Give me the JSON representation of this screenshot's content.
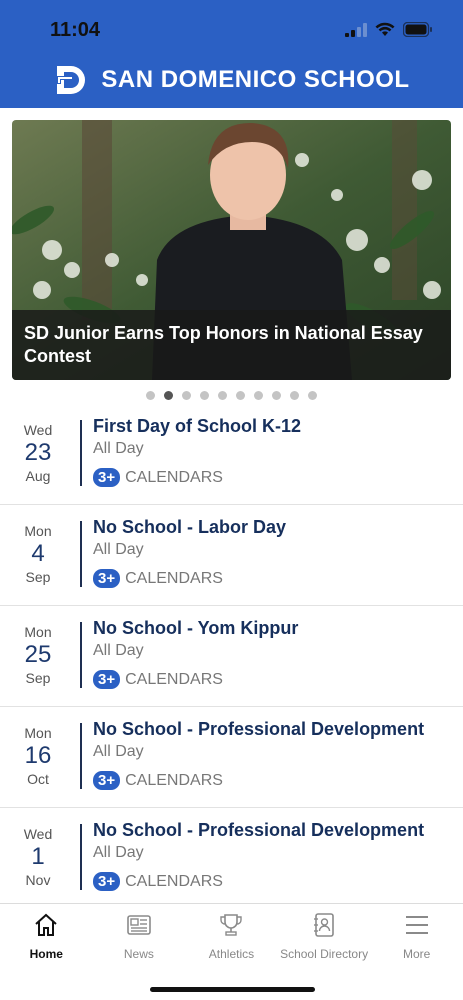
{
  "status_bar": {
    "time": "11:04"
  },
  "header": {
    "title": "SAN DOMENICO SCHOOL"
  },
  "hero": {
    "caption": "SD Junior Earns Top Honors in National Essay Contest"
  },
  "carousel": {
    "count": 10,
    "active_index": 1
  },
  "events": [
    {
      "dow": "Wed",
      "day": "23",
      "month": "Aug",
      "title": "First Day of School K-12",
      "time": "All Day",
      "badge": "3+",
      "calendars_label": "CALENDARS"
    },
    {
      "dow": "Mon",
      "day": "4",
      "month": "Sep",
      "title": "No School - Labor Day",
      "time": "All Day",
      "badge": "3+",
      "calendars_label": "CALENDARS"
    },
    {
      "dow": "Mon",
      "day": "25",
      "month": "Sep",
      "title": "No School - Yom Kippur",
      "time": "All Day",
      "badge": "3+",
      "calendars_label": "CALENDARS"
    },
    {
      "dow": "Mon",
      "day": "16",
      "month": "Oct",
      "title": "No School - Professional Development",
      "time": "All Day",
      "badge": "3+",
      "calendars_label": "CALENDARS"
    },
    {
      "dow": "Wed",
      "day": "1",
      "month": "Nov",
      "title": "No School - Professional Development",
      "time": "All Day",
      "badge": "3+",
      "calendars_label": "CALENDARS"
    }
  ],
  "tabs": [
    {
      "label": "Home",
      "icon": "home-icon",
      "active": true
    },
    {
      "label": "News",
      "icon": "news-icon",
      "active": false
    },
    {
      "label": "Athletics",
      "icon": "trophy-icon",
      "active": false
    },
    {
      "label": "School Directory",
      "icon": "directory-icon",
      "active": false
    },
    {
      "label": "More",
      "icon": "menu-icon",
      "active": false
    }
  ],
  "colors": {
    "brand": "#2b60c4",
    "title_text": "#162f5c",
    "badge": "#2b60c4"
  }
}
